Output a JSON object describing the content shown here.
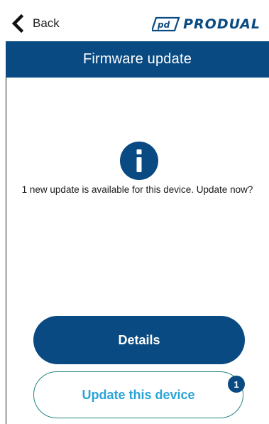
{
  "header": {
    "back_label": "Back",
    "brand": "PRODUAL"
  },
  "title": "Firmware update",
  "info": {
    "icon": "info-icon",
    "message": "1 new update is available for this device. Update now?"
  },
  "buttons": {
    "details_label": "Details",
    "update_label": "Update this device",
    "update_badge": "1"
  },
  "colors": {
    "brand_blue": "#0a4a82",
    "update_text": "#2aa3d8",
    "update_border": "#25877f"
  }
}
